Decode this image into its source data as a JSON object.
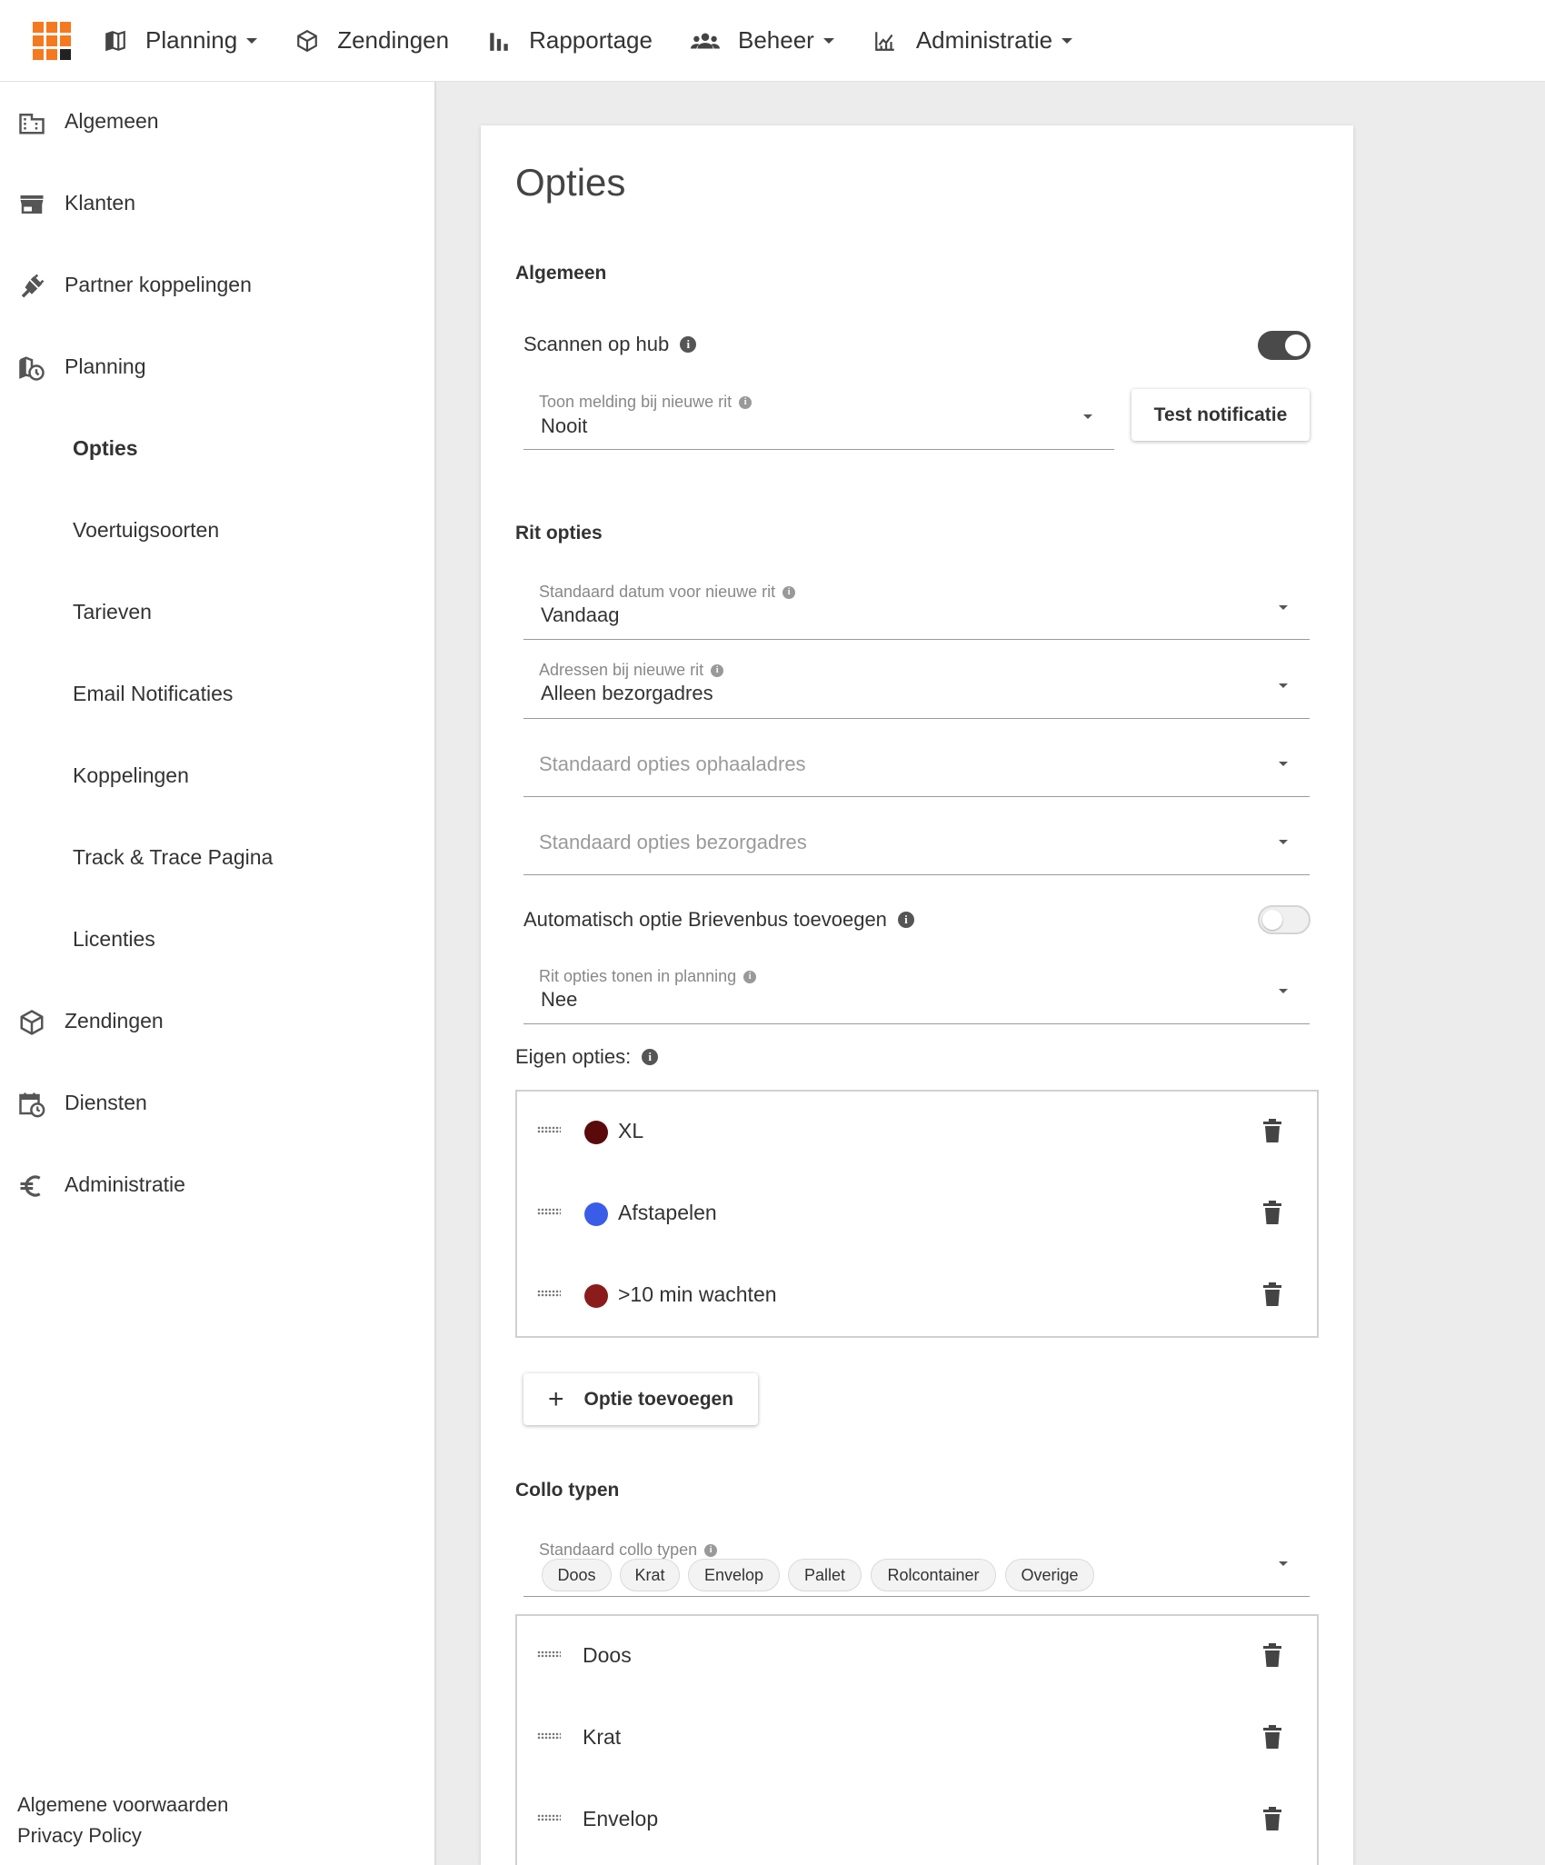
{
  "topnav": {
    "items": [
      {
        "label": "Planning",
        "icon": "map-icon",
        "has_dropdown": true
      },
      {
        "label": "Zendingen",
        "icon": "box-icon",
        "has_dropdown": false
      },
      {
        "label": "Rapportage",
        "icon": "bar-chart-icon",
        "has_dropdown": false
      },
      {
        "label": "Beheer",
        "icon": "people-icon",
        "has_dropdown": true
      },
      {
        "label": "Administratie",
        "icon": "finance-chart-icon",
        "has_dropdown": true
      }
    ],
    "logo_colors": [
      "#f5791f",
      "#f5791f",
      "#f5791f",
      "#f5791f",
      "#f5791f",
      "#f5791f",
      "#f5791f",
      "#f5791f",
      "#222222"
    ]
  },
  "sidebar": {
    "items": [
      {
        "label": "Algemeen",
        "icon": "building-icon"
      },
      {
        "label": "Klanten",
        "icon": "store-icon"
      },
      {
        "label": "Partner koppelingen",
        "icon": "plug-icon"
      },
      {
        "label": "Planning",
        "icon": "map-clock-icon"
      },
      {
        "label": "Opties",
        "sub": true,
        "active": true
      },
      {
        "label": "Voertuigsoorten",
        "sub": true
      },
      {
        "label": "Tarieven",
        "sub": true
      },
      {
        "label": "Email Notificaties",
        "sub": true
      },
      {
        "label": "Koppelingen",
        "sub": true
      },
      {
        "label": "Track & Trace Pagina",
        "sub": true
      },
      {
        "label": "Licenties",
        "sub": true
      },
      {
        "label": "Zendingen",
        "icon": "box-icon"
      },
      {
        "label": "Diensten",
        "icon": "calendar-clock-icon"
      },
      {
        "label": "Administratie",
        "icon": "euro-icon"
      }
    ],
    "footer": {
      "terms": "Algemene voorwaarden",
      "privacy": "Privacy Policy"
    }
  },
  "main": {
    "title": "Opties",
    "algemeen": {
      "heading": "Algemeen",
      "scan_hub_label": "Scannen op hub",
      "scan_hub_on": true,
      "notify_label": "Toon melding bij nieuwe rit",
      "notify_value": "Nooit",
      "test_button": "Test notificatie"
    },
    "rit_opties": {
      "heading": "Rit opties",
      "date_label": "Standaard datum voor nieuwe rit",
      "date_value": "Vandaag",
      "addr_label": "Adressen bij nieuwe rit",
      "addr_value": "Alleen bezorgadres",
      "pickup_placeholder": "Standaard opties ophaaladres",
      "delivery_placeholder": "Standaard opties bezorgadres",
      "mailbox_label": "Automatisch optie Brievenbus toevoegen",
      "mailbox_on": false,
      "show_label": "Rit opties tonen in planning",
      "show_value": "Nee"
    },
    "eigen_opties": {
      "label": "Eigen opties:",
      "items": [
        {
          "label": "XL",
          "color": "#5a0a0a"
        },
        {
          "label": "Afstapelen",
          "color": "#3a5de8"
        },
        {
          "label": ">10 min wachten",
          "color": "#8b1c1c"
        }
      ],
      "add_button": "Optie toevoegen"
    },
    "collo": {
      "heading": "Collo typen",
      "default_label": "Standaard collo typen",
      "chips": [
        "Doos",
        "Krat",
        "Envelop",
        "Pallet",
        "Rolcontainer",
        "Overige"
      ],
      "items": [
        "Doos",
        "Krat",
        "Envelop"
      ]
    }
  }
}
